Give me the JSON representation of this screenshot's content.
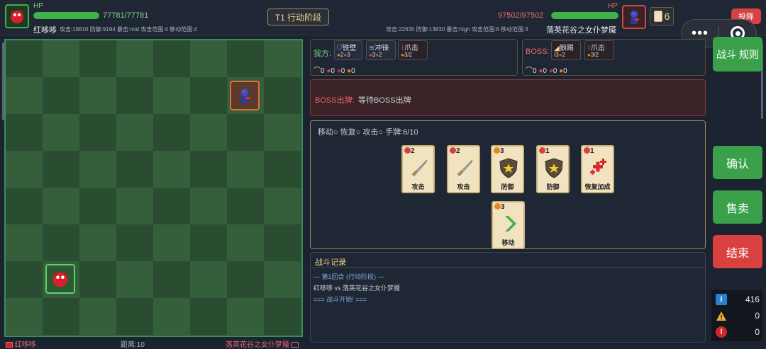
{
  "player": {
    "hp_label": "HP",
    "hp_text": "77781/77781",
    "hp_fraction": 1.0,
    "name": "红哆哆",
    "stats": "攻击:18810 防御:9194 暴击:mid 攻击范围:4 移动范围:4"
  },
  "phase": "T1 行动阶段",
  "boss": {
    "hp_label": "HP",
    "hp_text": "97502/97502",
    "hp_fraction": 1.0,
    "name": "落英花谷之女仆梦魇",
    "stats": "攻击:22635 防御:13830 暴击:high 攻击范围:8 移动范围:3",
    "card_count": "6"
  },
  "surrender_label": "投降",
  "capsule": {
    "more": "•••",
    "target": "target-icon"
  },
  "my_side": {
    "label": "我方:",
    "skills": [
      {
        "name": "铁壁",
        "icon": "shield-icon",
        "cost": "2 3"
      },
      {
        "name": "冲锋",
        "icon": "wind-icon",
        "cost": "3 2"
      },
      {
        "name": "爪击",
        "icon": "claw-icon",
        "cost": "3 2"
      }
    ],
    "resources": [
      "0",
      "0",
      "0",
      "0"
    ]
  },
  "boss_side": {
    "label": "BOSS:",
    "skills": [
      {
        "name": "狼踢",
        "icon": "kick-icon",
        "cost": "3 2"
      },
      {
        "name": "爪击",
        "icon": "claw-icon",
        "cost": "3 2"
      }
    ],
    "resources": [
      "0",
      "0",
      "0",
      "0"
    ]
  },
  "boss_play": {
    "label": "BOSS出牌:",
    "text": "等待BOSS出牌"
  },
  "hand_header": "移动○ 恢复○ 攻击○ 手牌:6/10",
  "cards": [
    {
      "cost": "2",
      "label": "攻击",
      "art": "sword-icon",
      "cost_color": "#d94141"
    },
    {
      "cost": "2",
      "label": "攻击",
      "art": "sword-icon",
      "cost_color": "#d94141"
    },
    {
      "cost": "3",
      "label": "防御",
      "art": "shield-star-icon",
      "cost_color": "#e08a1c"
    },
    {
      "cost": "1",
      "label": "防御",
      "art": "shield-star-icon",
      "cost_color": "#d94141"
    },
    {
      "cost": "1",
      "label": "恢复加成",
      "art": "heal-cross-icon",
      "cost_color": "#d94141"
    },
    {
      "cost": "3",
      "label": "移动",
      "art": "move-arrow-icon",
      "cost_color": "#e08a1c"
    }
  ],
  "log": {
    "title": "战斗记录",
    "lines": [
      {
        "text": "--- 第1回合 (行动阶段) ---",
        "color": "#7fa8d8"
      },
      {
        "text": "红哆哆 vs 落英花谷之女仆梦魇",
        "color": "#c9cfd8"
      },
      {
        "text": "=== 战斗开始! ===",
        "color": "#7fa8d8"
      }
    ]
  },
  "buttons": {
    "rules": "战斗 规则",
    "confirm": "确认",
    "sell": "售卖",
    "end": "结束"
  },
  "counters": {
    "info": "416",
    "warn": "0",
    "error": "0"
  },
  "board_footer": {
    "left": "红哆哆",
    "mid": "距离:10",
    "right": "落英花谷之女仆梦魇"
  },
  "colors": {
    "accent_green": "#3aa14a",
    "accent_red": "#d94141",
    "gold": "#f0d48a",
    "hp_green": "#3fb24a"
  }
}
